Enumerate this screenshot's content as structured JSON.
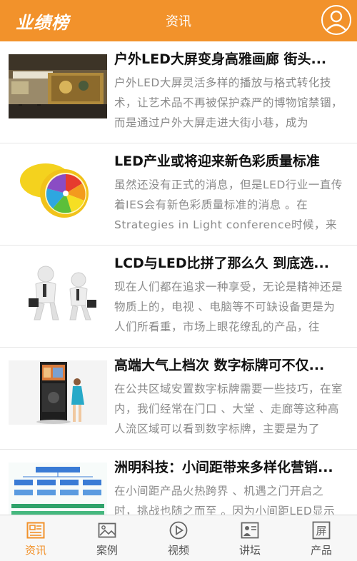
{
  "app": {
    "logo": "业绩榜",
    "page_title": "资讯"
  },
  "colors": {
    "accent": "#f2922b",
    "summary_text": "#8a8a8a"
  },
  "articles": [
    {
      "title": "户外LED大屏变身高雅画廊 街头...",
      "summary": "户外LED大屏灵活多样的播放与格式转化技术，让艺术品不再被保护森严的博物馆禁锢，而是通过户外大屏走进大街小巷，成为",
      "thumb_icon": "metro-gallery-image"
    },
    {
      "title": "LED产业或将迎来新色彩质量标准",
      "summary": "虽然还没有正式的消息，但是LED行业一直传着IES会有新色彩质量标准的消息 。在Strategies in Light conference时候，来自",
      "thumb_icon": "rainbow-lemon-image"
    },
    {
      "title": "LCD与LED比拼了那么久 到底选...",
      "summary": "现在人们都在追求一种享受，无论是精神还是物质上的，电视 、电脑等不可缺设备更是为人们所看重，市场上眼花缭乱的产品，往",
      "thumb_icon": "businessmen-3d-image"
    },
    {
      "title": "高端大气上档次 数字标牌可不仅...",
      "summary": "在公共区域安置数字标牌需要一些技巧，在室内，我们经常在门口 、大堂 、走廊等这种高人流区域可以看到数字标牌，主要是为了",
      "thumb_icon": "digital-signage-image"
    },
    {
      "title": "洲明科技：小间距带来多样化营销...",
      "summary": "在小间距产品火热跨界 、机遇之门开启之时，挑战也随之而至 。因为小间距LED显示",
      "thumb_icon": "flowchart-image"
    }
  ],
  "tabs": [
    {
      "label": "资讯",
      "icon": "news-icon",
      "active": true
    },
    {
      "label": "案例",
      "icon": "image-icon",
      "active": false
    },
    {
      "label": "视频",
      "icon": "play-icon",
      "active": false
    },
    {
      "label": "讲坛",
      "icon": "lecture-icon",
      "active": false
    },
    {
      "label": "产品",
      "icon": "screen-icon",
      "active": false
    }
  ]
}
